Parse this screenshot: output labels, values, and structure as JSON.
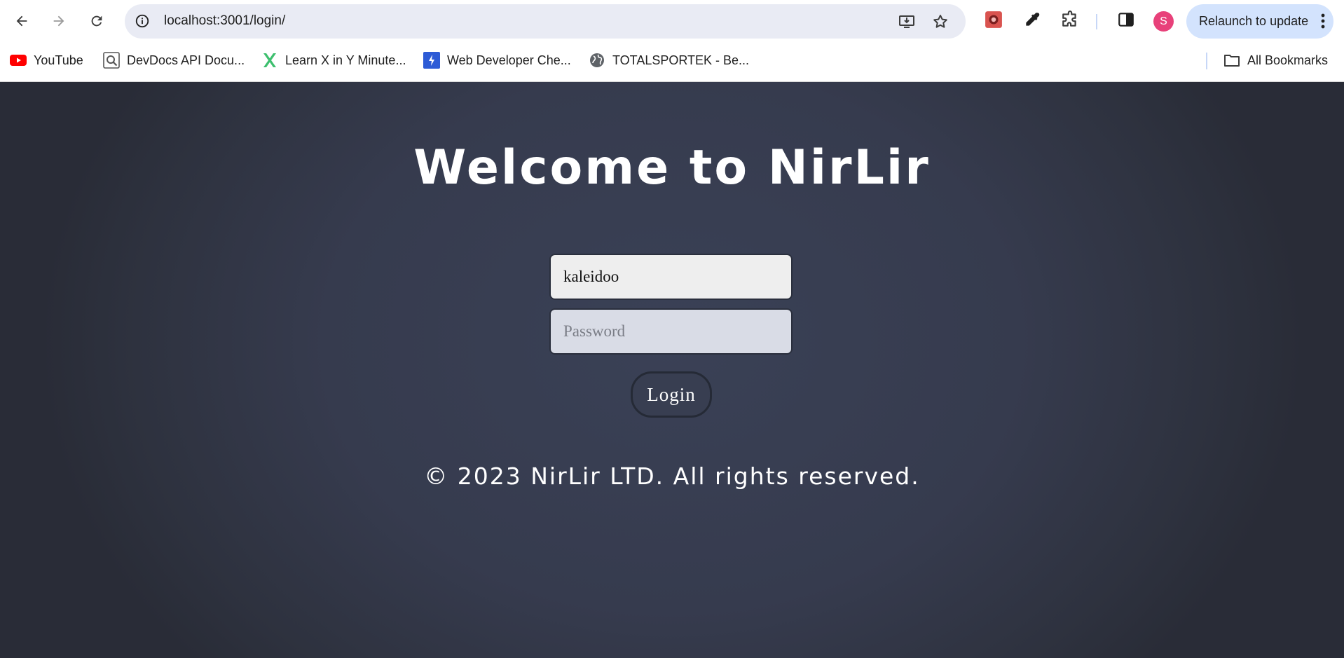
{
  "browser": {
    "url": "localhost:3001/login/",
    "profile_initial": "S",
    "relaunch_label": "Relaunch to update",
    "bookmarks": [
      {
        "label": "YouTube",
        "icon": "youtube-icon"
      },
      {
        "label": "DevDocs API Docu...",
        "icon": "devdocs-icon"
      },
      {
        "label": "Learn X in Y Minute...",
        "icon": "learnx-icon"
      },
      {
        "label": "Web Developer Che...",
        "icon": "webdev-icon"
      },
      {
        "label": "TOTALSPORTEK - Be...",
        "icon": "globe-icon"
      }
    ],
    "all_bookmarks_label": "All Bookmarks"
  },
  "login": {
    "title": "Welcome to NirLir",
    "username_value": "kaleidoo",
    "password_placeholder": "Password",
    "login_label": "Login"
  },
  "footer": {
    "text": "© 2023 NirLir LTD. All rights reserved."
  },
  "colors": {
    "page_bg": "#363b4e",
    "button_bg": "#383e51",
    "omnibox_bg": "#e9ebf4",
    "relaunch_bg": "#d3e3fd",
    "avatar_bg": "#e8417a"
  }
}
